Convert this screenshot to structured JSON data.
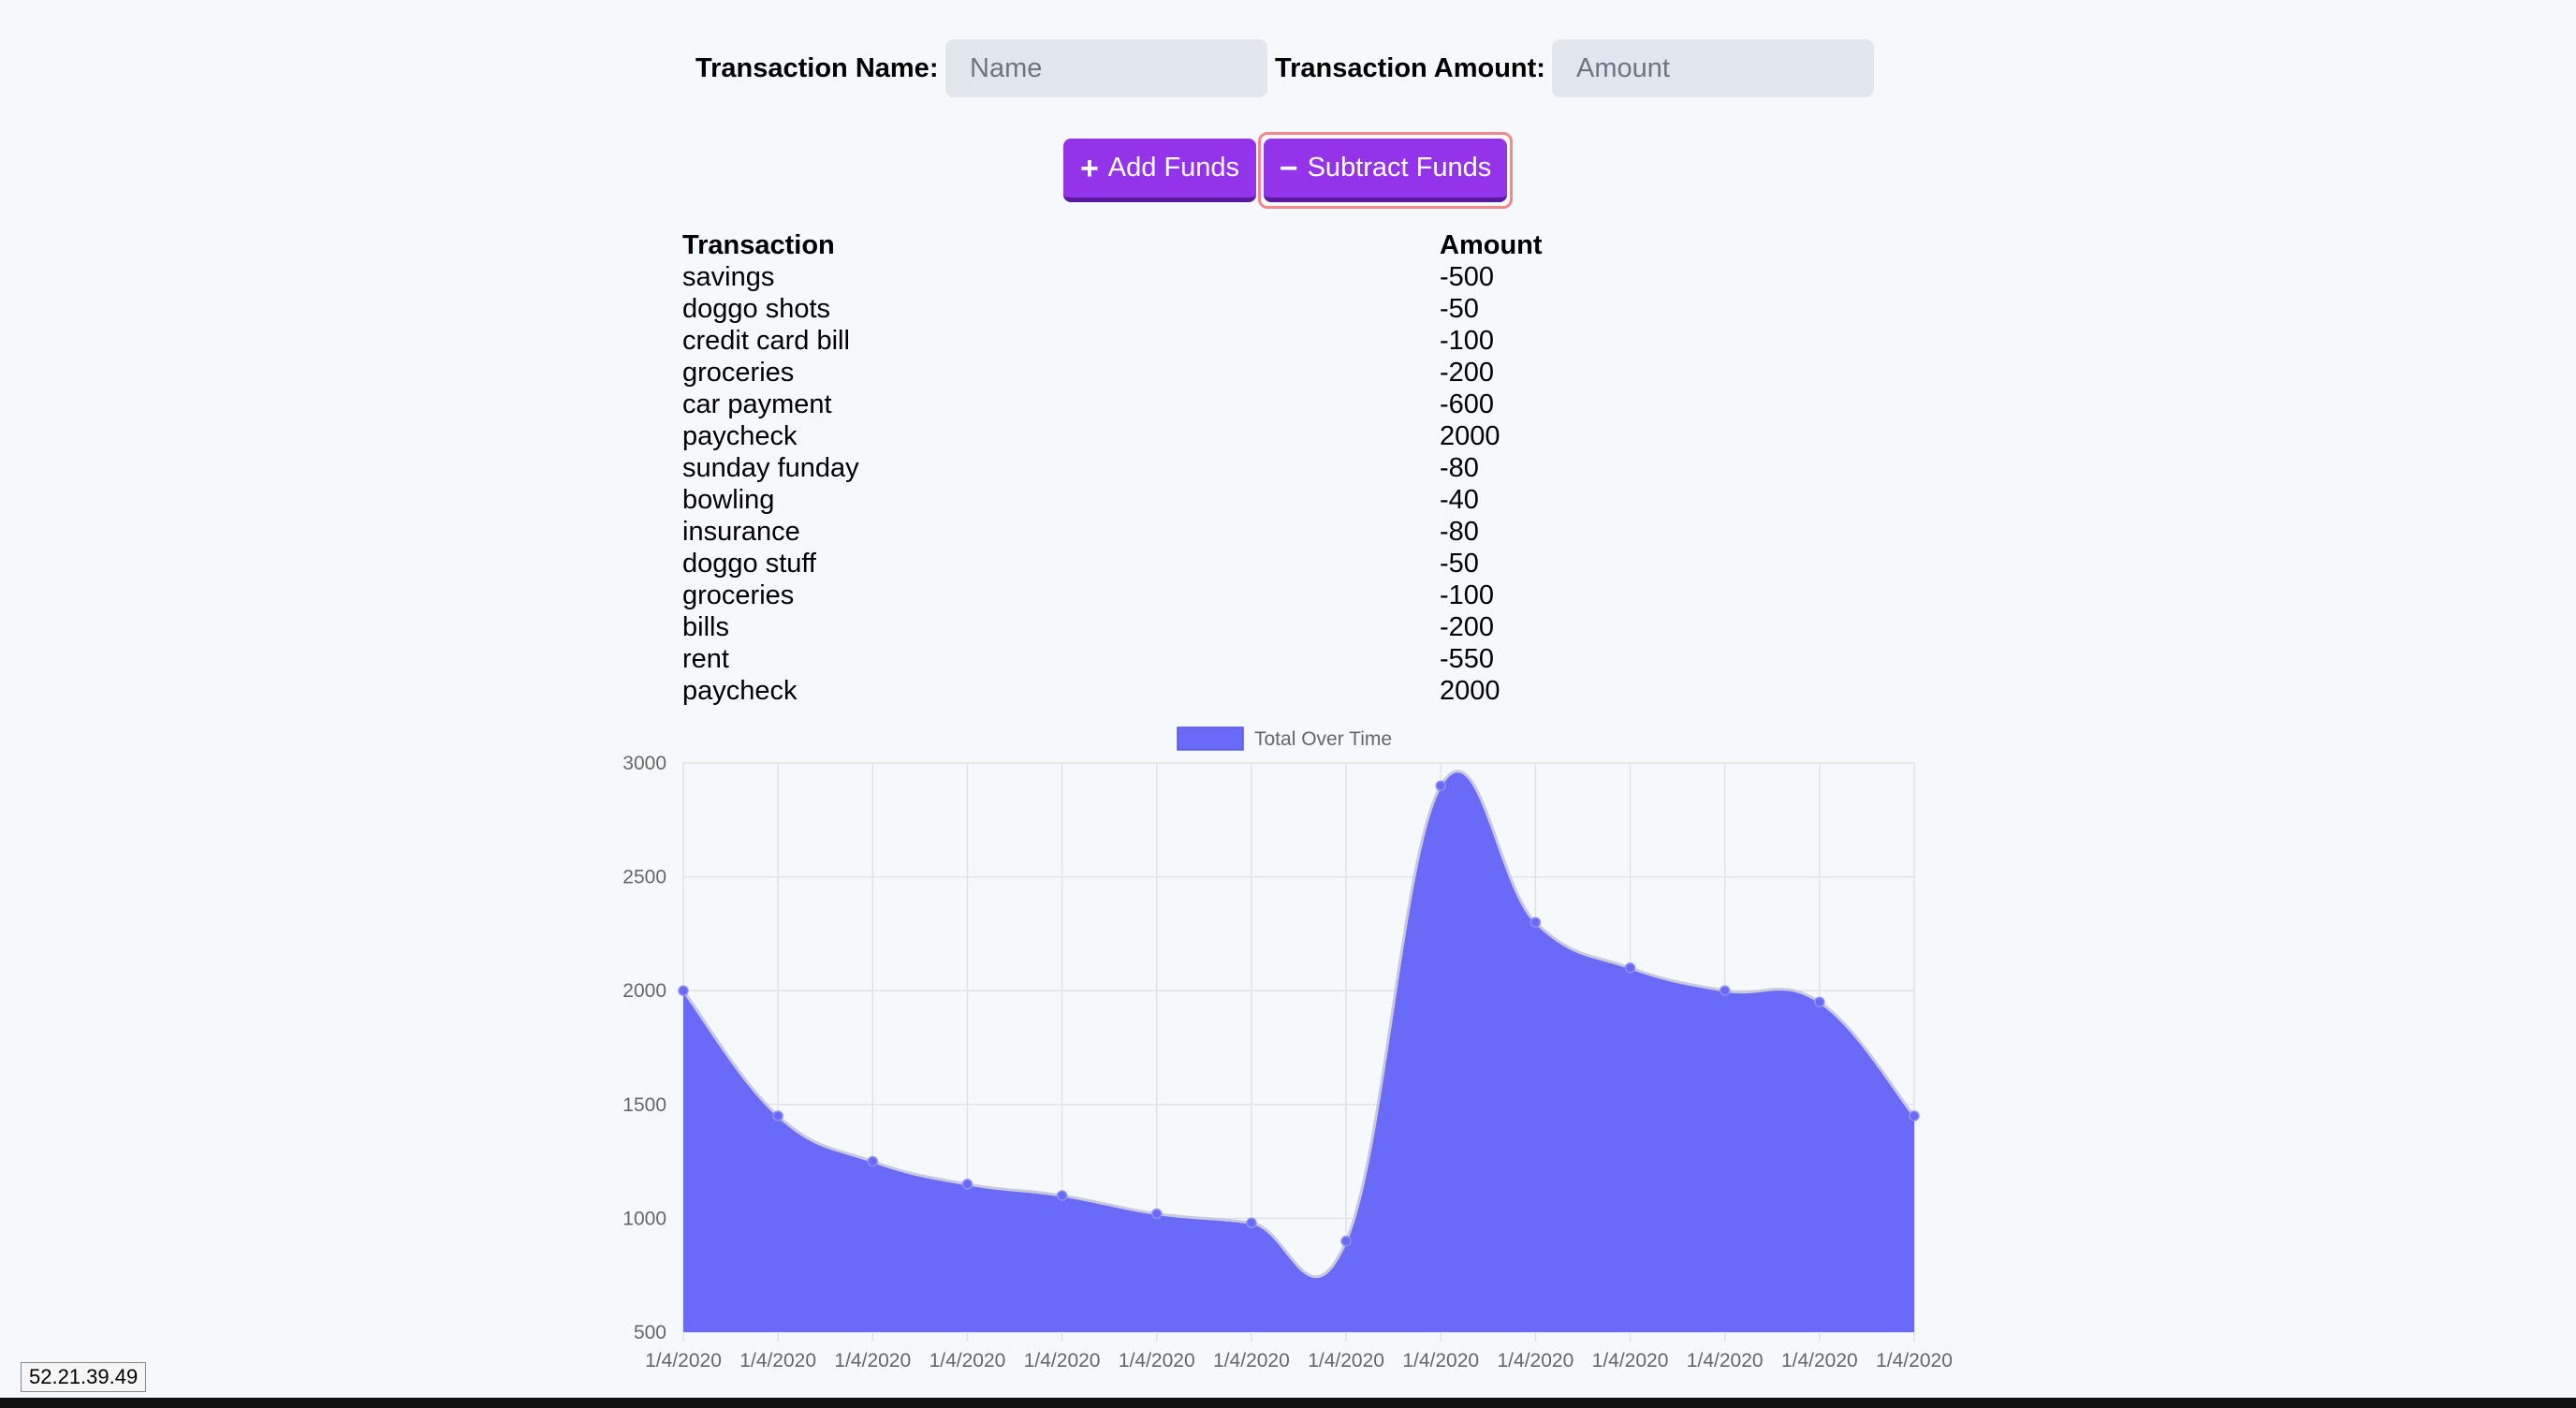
{
  "form": {
    "name_label": "Transaction Name:",
    "name_placeholder": "Name",
    "amount_label": "Transaction Amount:",
    "amount_placeholder": "Amount"
  },
  "buttons": {
    "add_label": "Add Funds",
    "add_icon": "plus-icon",
    "subtract_label": "Subtract Funds",
    "subtract_icon": "minus-icon",
    "accent_color": "#9333ea",
    "focus_ring_color": "#f2888b"
  },
  "table": {
    "headers": [
      "Transaction",
      "Amount"
    ],
    "rows": [
      {
        "name": "savings",
        "amount": "-500"
      },
      {
        "name": "doggo shots",
        "amount": "-50"
      },
      {
        "name": "credit card bill",
        "amount": "-100"
      },
      {
        "name": "groceries",
        "amount": "-200"
      },
      {
        "name": "car payment",
        "amount": "-600"
      },
      {
        "name": "paycheck",
        "amount": "2000"
      },
      {
        "name": "sunday funday",
        "amount": "-80"
      },
      {
        "name": "bowling",
        "amount": "-40"
      },
      {
        "name": "insurance",
        "amount": "-80"
      },
      {
        "name": "doggo stuff",
        "amount": "-50"
      },
      {
        "name": "groceries",
        "amount": "-100"
      },
      {
        "name": "bills",
        "amount": "-200"
      },
      {
        "name": "rent",
        "amount": "-550"
      },
      {
        "name": "paycheck",
        "amount": "2000"
      }
    ]
  },
  "chart_data": {
    "type": "area",
    "title": "",
    "xlabel": "",
    "ylabel": "",
    "legend": "top-center",
    "grid": true,
    "categories": [
      "1/4/2020",
      "1/4/2020",
      "1/4/2020",
      "1/4/2020",
      "1/4/2020",
      "1/4/2020",
      "1/4/2020",
      "1/4/2020",
      "1/4/2020",
      "1/4/2020",
      "1/4/2020",
      "1/4/2020",
      "1/4/2020",
      "1/4/2020"
    ],
    "series": [
      {
        "name": "Total Over Time",
        "values": [
          2000,
          1450,
          1250,
          1150,
          1100,
          1020,
          980,
          900,
          2900,
          2300,
          2100,
          2000,
          1950,
          1450
        ],
        "color": "#6a6af8"
      }
    ],
    "yticks": [
      500,
      1000,
      1500,
      2000,
      2500,
      3000
    ],
    "ylim": [
      500,
      3000
    ]
  },
  "status": {
    "ip": "52.21.39.49"
  }
}
